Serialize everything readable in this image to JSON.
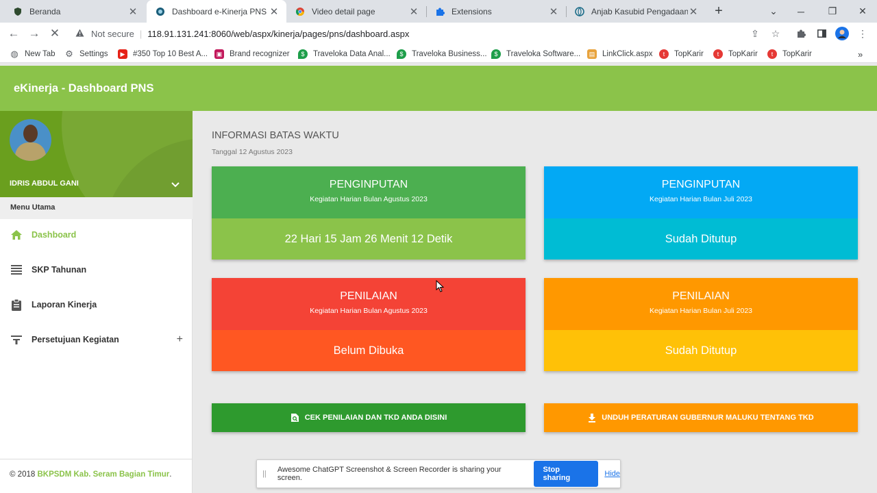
{
  "browser": {
    "tabs": [
      {
        "title": "Beranda",
        "icon": "shield-icon",
        "active": false
      },
      {
        "title": "Dashboard e-Kinerja PNS",
        "icon": "eye-icon",
        "active": true
      },
      {
        "title": "Video detail page",
        "icon": "chrome-icon",
        "active": false
      },
      {
        "title": "Extensions",
        "icon": "puzzle-icon",
        "active": false
      },
      {
        "title": "Anjab Kasubid Pengadaan D",
        "icon": "globe-icon",
        "active": false
      }
    ],
    "security_label": "Not secure",
    "url": "118.91.131.241:8060/web/aspx/kinerja/pages/pns/dashboard.aspx",
    "bookmarks": [
      {
        "label": "New Tab",
        "icon": "globe-icon",
        "color": "#5f6368"
      },
      {
        "label": "Settings",
        "icon": "gear-icon",
        "color": "#5f6368"
      },
      {
        "label": "#350 Top 10 Best A...",
        "icon": "youtube-icon",
        "color": "#e62117"
      },
      {
        "label": "Brand recognizer",
        "icon": "app-icon",
        "color": "#c2185b"
      },
      {
        "label": "Traveloka Data Anal...",
        "icon": "location-icon",
        "color": "#1e9e4a"
      },
      {
        "label": "Traveloka Business...",
        "icon": "location-icon",
        "color": "#1e9e4a"
      },
      {
        "label": "Traveloka Software...",
        "icon": "location-icon",
        "color": "#1e9e4a"
      },
      {
        "label": "LinkClick.aspx",
        "icon": "page-icon",
        "color": "#e8a33d"
      },
      {
        "label": "TopKarir",
        "icon": "topkarir-icon",
        "color": "#e53935"
      },
      {
        "label": "TopKarir",
        "icon": "topkarir-icon",
        "color": "#e53935"
      },
      {
        "label": "TopKarir",
        "icon": "topkarir-icon",
        "color": "#e53935"
      }
    ]
  },
  "app": {
    "title": "eKinerja - Dashboard PNS",
    "accent": "#8bc34a"
  },
  "sidebar": {
    "user_name": "IDRIS ABDUL GANI",
    "menu_heading": "Menu Utama",
    "items": [
      {
        "label": "Dashboard",
        "icon": "home-icon",
        "active": true
      },
      {
        "label": "SKP Tahunan",
        "icon": "list-icon",
        "active": false
      },
      {
        "label": "Laporan Kinerja",
        "icon": "clipboard-icon",
        "active": false
      },
      {
        "label": "Persetujuan Kegiatan",
        "icon": "filter-icon",
        "active": false,
        "expandable": true
      }
    ],
    "footer_prefix": "© 2018",
    "footer_org": "BKPSDM Kab. Seram Bagian Timur",
    "footer_suffix": "."
  },
  "main": {
    "section_title": "INFORMASI BATAS WAKTU",
    "date_text": "Tanggal 12 Agustus 2023",
    "cards": [
      {
        "title": "PENGINPUTAN",
        "subtitle": "Kegiatan Harian Bulan Agustus 2023",
        "value": "22 Hari 15 Jam 26 Menit 12 Detik",
        "top_color": "#4caf50",
        "bottom_color": "#8bc34a"
      },
      {
        "title": "PENGINPUTAN",
        "subtitle": "Kegiatan Harian Bulan Juli 2023",
        "value": "Sudah Ditutup",
        "top_color": "#03a9f4",
        "bottom_color": "#00bcd4"
      },
      {
        "title": "PENILAIAN",
        "subtitle": "Kegiatan Harian Bulan Agustus 2023",
        "value": "Belum Dibuka",
        "top_color": "#f44336",
        "bottom_color": "#ff5722"
      },
      {
        "title": "PENILAIAN",
        "subtitle": "Kegiatan Harian Bulan Juli 2023",
        "value": "Sudah Ditutup",
        "top_color": "#ff9800",
        "bottom_color": "#ffc107"
      }
    ],
    "buttons": [
      {
        "label": "CEK PENILAIAN DAN TKD ANDA DISINI",
        "icon": "search-doc-icon",
        "color": "#2e9a2e"
      },
      {
        "label": "UNDUH PERATURAN GUBERNUR MALUKU TENTANG TKD",
        "icon": "download-icon",
        "color": "#ff9800"
      }
    ]
  },
  "share_bar": {
    "message": "Awesome ChatGPT Screenshot & Screen Recorder is sharing your screen.",
    "stop_label": "Stop sharing",
    "hide_label": "Hide"
  }
}
